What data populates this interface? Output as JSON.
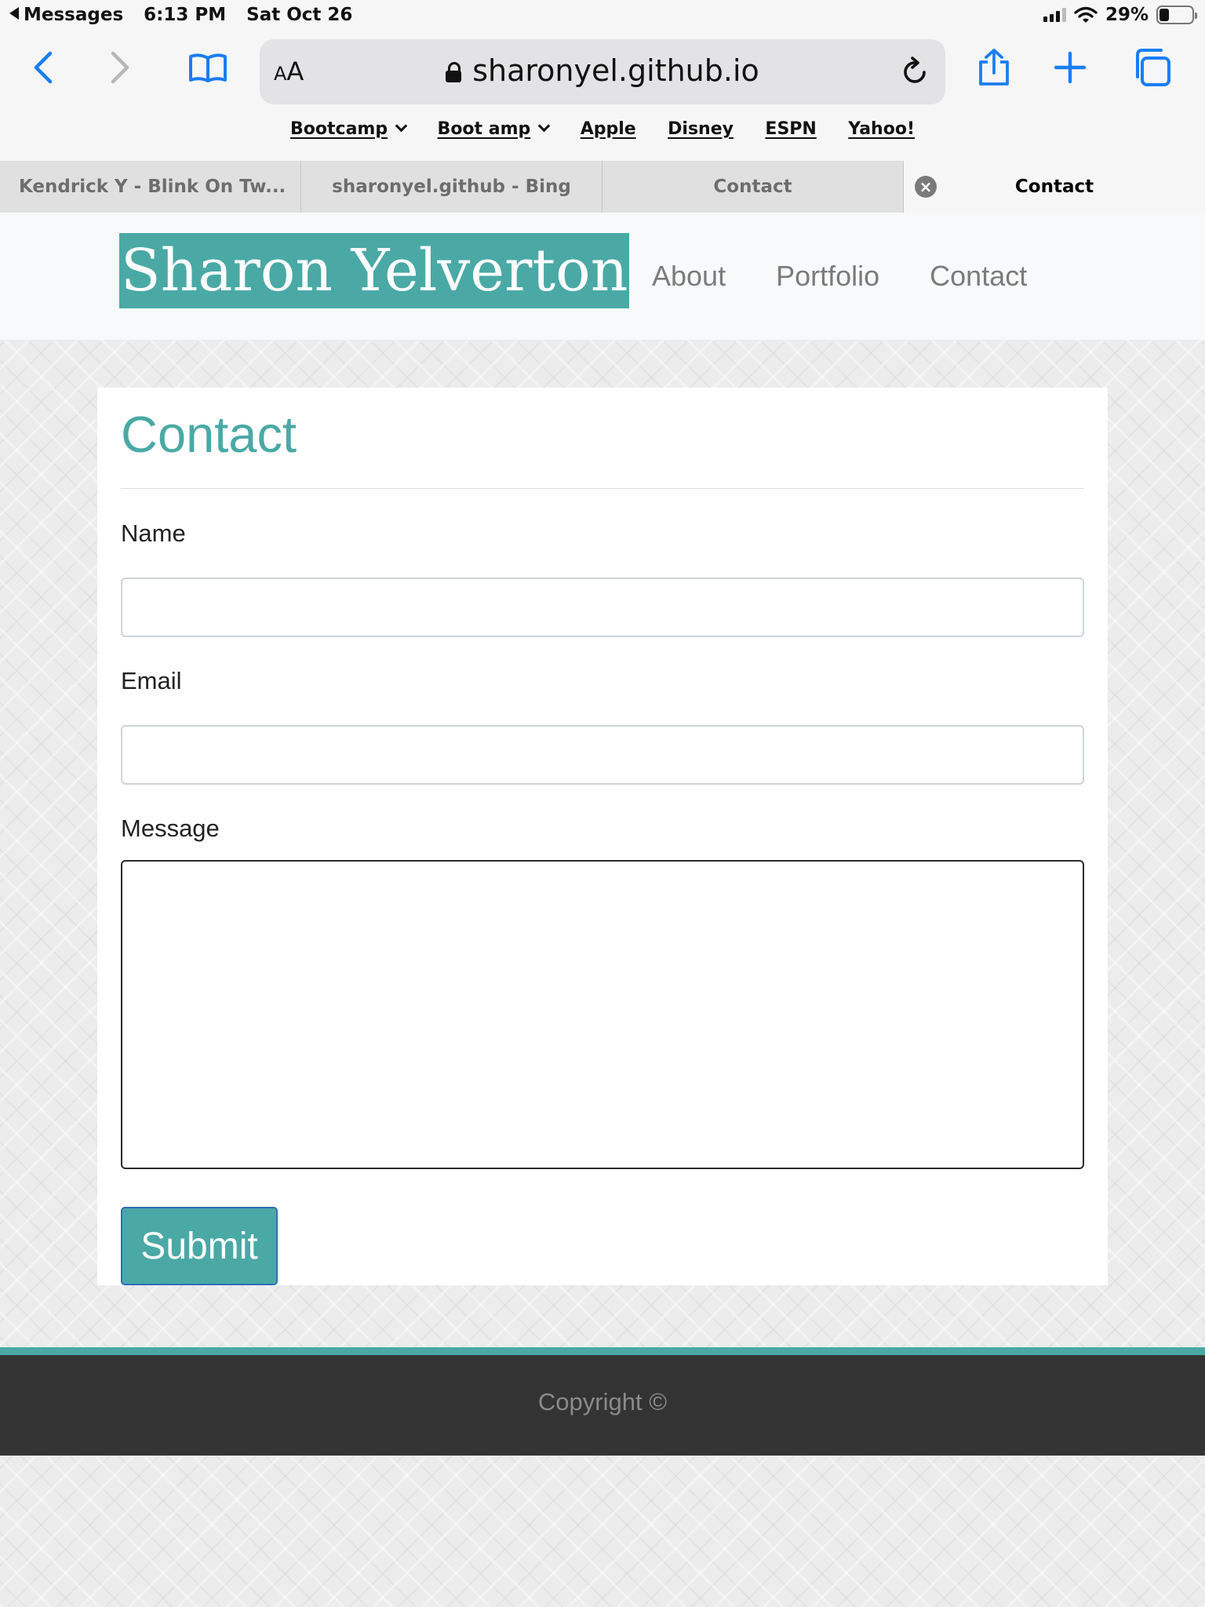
{
  "status_bar": {
    "back_app": "Messages",
    "time": "6:13 PM",
    "date": "Sat Oct 26",
    "battery": "29%"
  },
  "browser": {
    "address_text_size_label_small": "A",
    "address_text_size_label_big": "A",
    "url": "sharonyel.github.io",
    "favorites": [
      {
        "label": "Bootcamp",
        "folder": true
      },
      {
        "label": "Boot amp",
        "folder": true
      },
      {
        "label": "Apple",
        "folder": false
      },
      {
        "label": "Disney",
        "folder": false
      },
      {
        "label": "ESPN",
        "folder": false
      },
      {
        "label": "Yahoo!",
        "folder": false
      }
    ],
    "tabs": [
      {
        "title": "Kendrick Y - Blink On Tw..."
      },
      {
        "title": "sharonyel.github - Bing"
      },
      {
        "title": "Contact"
      },
      {
        "title": "Contact",
        "active": true
      }
    ],
    "tab_close_glyph": "×",
    "icons": [
      "back-icon",
      "forward-icon",
      "bookmarks-icon",
      "lock-icon",
      "reload-icon",
      "share-icon",
      "new-tab-icon",
      "tabs-overview-icon"
    ]
  },
  "site": {
    "brand": "Sharon Yelverton",
    "nav": [
      "About",
      "Portfolio",
      "Contact"
    ],
    "accent_color": "#4aa9a5",
    "footer_color": "#333333"
  },
  "contact": {
    "title": "Contact",
    "name_label": "Name",
    "name_value": "",
    "email_label": "Email",
    "email_value": "",
    "message_label": "Message",
    "message_value": "",
    "submit_label": "Submit"
  },
  "footer": {
    "copyright": "Copyright ©"
  }
}
